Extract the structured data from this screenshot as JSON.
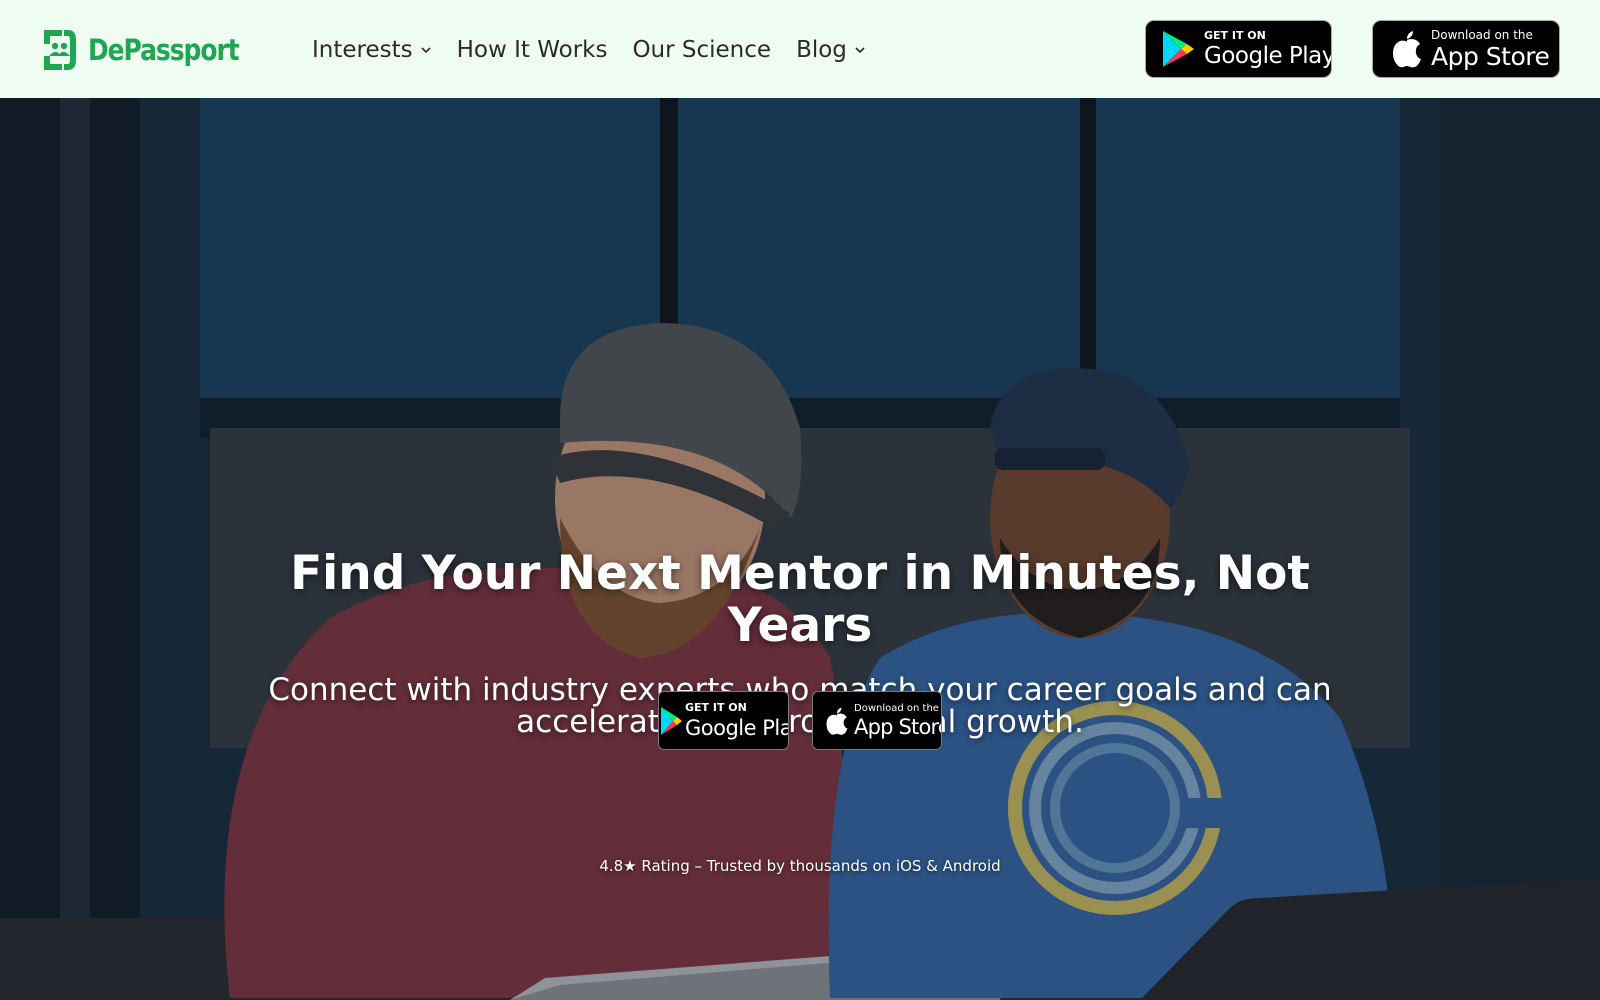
{
  "brand": {
    "name": "DePassport",
    "color": "#1fa653"
  },
  "nav": {
    "items": [
      {
        "label": "Interests",
        "has_dropdown": true
      },
      {
        "label": "How It Works",
        "has_dropdown": false
      },
      {
        "label": "Our Science",
        "has_dropdown": false
      },
      {
        "label": "Blog",
        "has_dropdown": true
      }
    ]
  },
  "header_badges": {
    "google": {
      "small": "GET IT ON",
      "big": "Google Play",
      "icon": "google-play-icon"
    },
    "apple": {
      "small": "Download on the",
      "big": "App Store",
      "icon": "apple-icon"
    }
  },
  "hero": {
    "title": "Find Your Next Mentor in Minutes, Not Years",
    "subtitle": "Connect with industry experts who match your career goals and can accelerate your professional growth.",
    "badges": {
      "google": {
        "small": "GET IT ON",
        "big": "Google Play",
        "icon": "google-play-icon"
      },
      "apple": {
        "small": "Download on the",
        "big": "App Store",
        "icon": "apple-icon"
      }
    },
    "rating": "4.8★ Rating – Trusted by thousands on iOS & Android",
    "background_image": "two-smiling-men-with-laptops"
  },
  "colors": {
    "header_bg": "#effcf2",
    "badge_bg": "#000000",
    "text_dark": "#2b2b2b"
  }
}
